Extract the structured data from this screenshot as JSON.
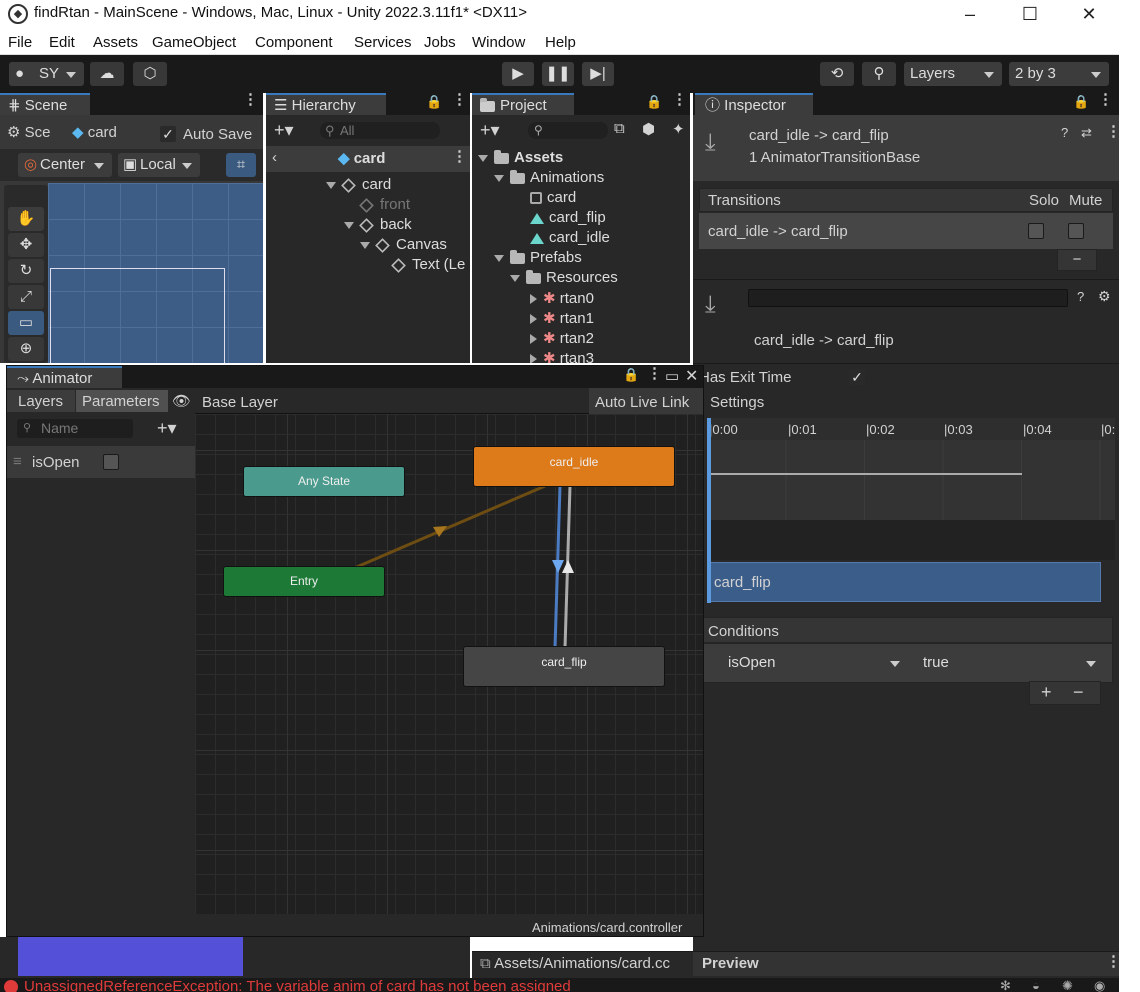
{
  "window": {
    "title": "findRtan - MainScene - Windows, Mac, Linux - Unity 2022.3.11f1* <DX11>"
  },
  "menu": [
    "File",
    "Edit",
    "Assets",
    "GameObject",
    "Component",
    "Services",
    "Jobs",
    "Window",
    "Help"
  ],
  "toolbar": {
    "account": "SY",
    "layers": "Layers",
    "layout": "2 by 3"
  },
  "scene": {
    "tab": "Scene",
    "breadcrumb_scene": "Sce",
    "breadcrumb_object": "card",
    "auto_save": "Auto Save",
    "pivot": "Center",
    "space": "Local"
  },
  "hierarchy": {
    "tab": "Hierarchy",
    "search_placeholder": "All",
    "root": "card",
    "items": [
      "card",
      "front",
      "back",
      "Canvas",
      "Text (Le"
    ]
  },
  "project": {
    "tab": "Project",
    "items": [
      "Assets",
      "Animations",
      "card",
      "card_flip",
      "card_idle",
      "Prefabs",
      "Resources",
      "rtan0",
      "rtan1",
      "rtan2",
      "rtan3"
    ],
    "footer_path": "Assets/Animations/card.cc"
  },
  "inspector": {
    "tab": "Inspector",
    "header_title": "card_idle -> card_flip",
    "header_subtitle": "1 AnimatorTransitionBase",
    "transitions_label": "Transitions",
    "solo_label": "Solo",
    "mute_label": "Mute",
    "transition_row": "card_idle -> card_flip",
    "sub_title": "card_idle -> card_flip",
    "has_exit_time": "Has Exit Time",
    "settings": "Settings",
    "timeline_ticks": [
      "0:00",
      "0:01",
      "0:02",
      "0:03",
      "0:04",
      "0:"
    ],
    "clip_label": "card_flip",
    "conditions": "Conditions",
    "condition_param": "isOpen",
    "condition_value": "true",
    "preview": "Preview"
  },
  "animator": {
    "tab": "Animator",
    "layers_tab": "Layers",
    "parameters_tab": "Parameters",
    "base_layer": "Base Layer",
    "auto_live_link": "Auto Live Link",
    "search_placeholder": "Name",
    "param_name": "isOpen",
    "states": {
      "any": "Any State",
      "entry": "Entry",
      "idle": "card_idle",
      "flip": "card_flip"
    },
    "footer": "Animations/card.controller"
  },
  "console_error": "UnassignedReferenceException: The variable anim of card has not been assigned",
  "colors": {
    "accent": "#3a79bb",
    "state_default": "#dd7a1a",
    "state_entry": "#1d7a36",
    "state_any": "#4a9b8d",
    "error": "#e03b3b"
  }
}
